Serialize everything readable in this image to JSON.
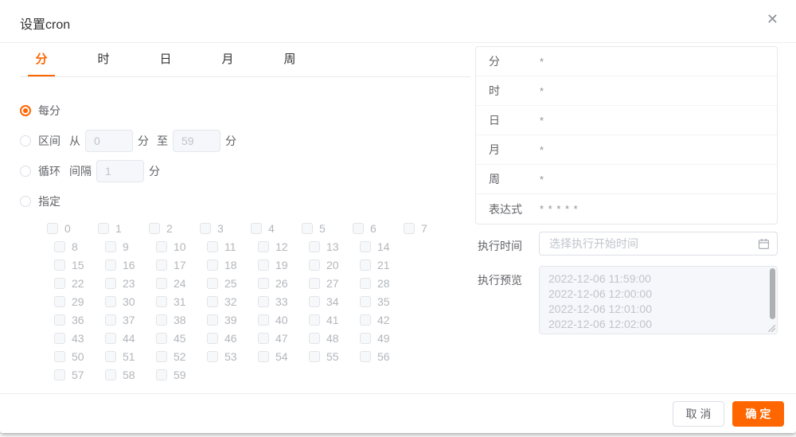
{
  "colors": {
    "accent": "#ff6600"
  },
  "dialog": {
    "title": "设置cron",
    "close_glyph": "✕"
  },
  "tabs": [
    {
      "label": "分",
      "active": true
    },
    {
      "label": "时",
      "active": false
    },
    {
      "label": "日",
      "active": false
    },
    {
      "label": "月",
      "active": false
    },
    {
      "label": "周",
      "active": false
    }
  ],
  "minute_panel": {
    "every": {
      "label": "每分"
    },
    "range": {
      "label": "区间",
      "from": "从",
      "from_value": "0",
      "from_unit": "分",
      "to": "至",
      "to_value": "59",
      "to_unit": "分"
    },
    "loop": {
      "label": "循环",
      "interval": "间隔",
      "interval_value": "1",
      "unit": "分"
    },
    "specify": {
      "label": "指定"
    },
    "checkbox_rows": [
      [
        "0",
        "1",
        "2",
        "3",
        "4",
        "5",
        "6",
        "7"
      ],
      [
        "8",
        "9",
        "10",
        "11",
        "12",
        "13",
        "14"
      ],
      [
        "15",
        "16",
        "17",
        "18",
        "19",
        "20",
        "21"
      ],
      [
        "22",
        "23",
        "24",
        "25",
        "26",
        "27",
        "28"
      ],
      [
        "29",
        "30",
        "31",
        "32",
        "33",
        "34",
        "35"
      ],
      [
        "36",
        "37",
        "38",
        "39",
        "40",
        "41",
        "42"
      ],
      [
        "43",
        "44",
        "45",
        "46",
        "47",
        "48",
        "49"
      ],
      [
        "50",
        "51",
        "52",
        "53",
        "54",
        "55",
        "56"
      ],
      [
        "57",
        "58",
        "59"
      ]
    ]
  },
  "summary": {
    "rows": [
      {
        "label": "分",
        "value": "*"
      },
      {
        "label": "时",
        "value": "*"
      },
      {
        "label": "日",
        "value": "*"
      },
      {
        "label": "月",
        "value": "*"
      },
      {
        "label": "周",
        "value": "*"
      },
      {
        "label": "表达式",
        "value": "* * * * *"
      }
    ]
  },
  "execution": {
    "time_label": "执行时间",
    "time_placeholder": "选择执行开始时间",
    "preview_label": "执行预览",
    "preview_lines": [
      "2022-12-06 11:59:00",
      "2022-12-06 12:00:00",
      "2022-12-06 12:01:00",
      "2022-12-06 12:02:00"
    ]
  },
  "footer": {
    "cancel": "取 消",
    "confirm": "确 定"
  }
}
